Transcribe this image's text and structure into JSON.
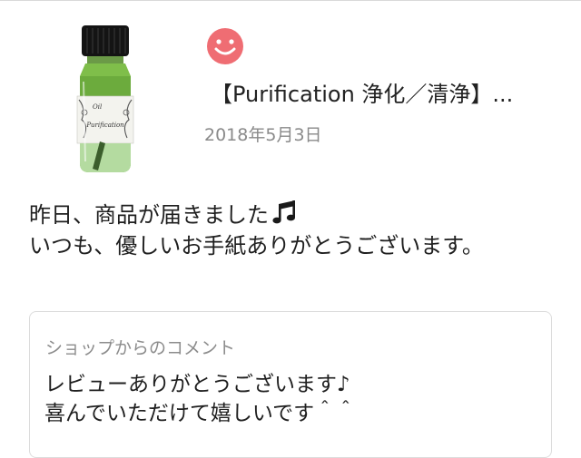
{
  "product": {
    "title": "【Purification 浄化／清浄】...",
    "image_icon": "essential-oil-bottle",
    "label_text": "Purification"
  },
  "review": {
    "avatar_icon": "smiley-face-icon",
    "date": "2018年5月3日",
    "line1": "昨日、商品が届きました",
    "line1_icon": "music-notes-icon",
    "line2": "いつも、優しいお手紙ありがとうございます。"
  },
  "shop_reply": {
    "label": "ショップからのコメント",
    "line1": "レビューありがとうございます♪",
    "line2": "喜んでいただけて嬉しいです＾＾"
  },
  "colors": {
    "avatar": "#ef6d73",
    "date_gray": "#8a8a8a",
    "border": "#dcdcdc"
  }
}
